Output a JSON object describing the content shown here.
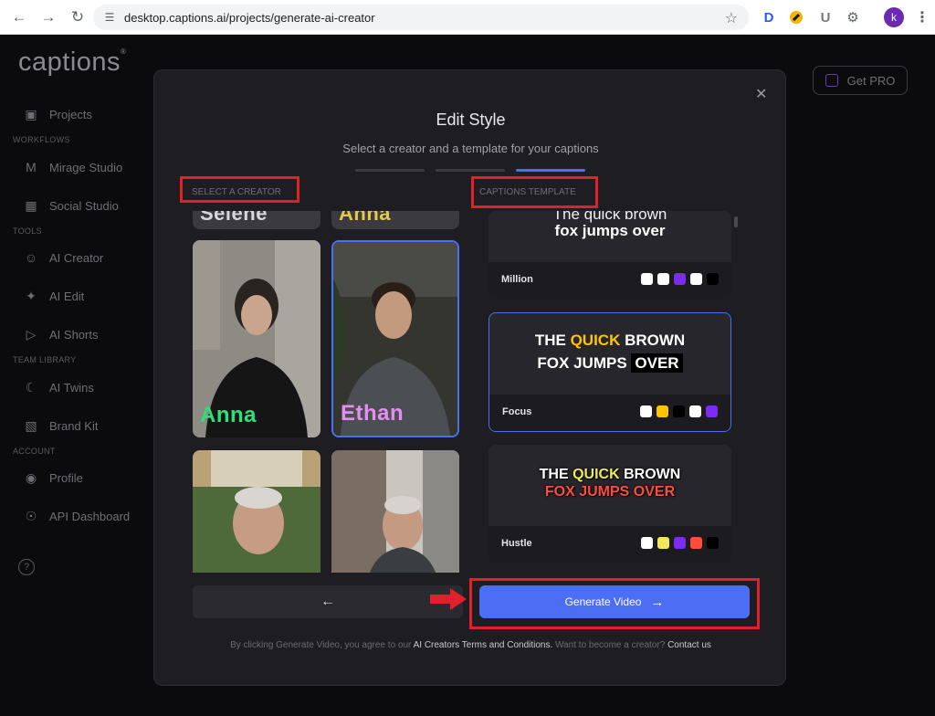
{
  "browser": {
    "url": "desktop.captions.ai/projects/generate-ai-creator",
    "profile_initial": "k",
    "ext_d": "D",
    "ext_u": "U"
  },
  "app": {
    "logo": "captions",
    "get_pro": "Get PRO",
    "sidebar": {
      "items": [
        {
          "label": "Projects",
          "icon": "projects-icon"
        },
        {
          "section": "WORKFLOWS"
        },
        {
          "label": "Mirage Studio",
          "icon": "mirage-icon"
        },
        {
          "label": "Social Studio",
          "icon": "social-icon"
        },
        {
          "section": "TOOLS"
        },
        {
          "label": "AI Creator",
          "icon": "ai-creator-icon"
        },
        {
          "label": "AI Edit",
          "icon": "ai-edit-icon"
        },
        {
          "label": "AI Shorts",
          "icon": "ai-shorts-icon"
        },
        {
          "section": "TEAM LIBRARY"
        },
        {
          "label": "AI Twins",
          "icon": "ai-twins-icon"
        },
        {
          "label": "Brand Kit",
          "icon": "brand-kit-icon"
        },
        {
          "section": "ACCOUNT"
        },
        {
          "label": "Profile",
          "icon": "profile-icon"
        },
        {
          "label": "API Dashboard",
          "icon": "api-icon"
        }
      ]
    }
  },
  "modal": {
    "title": "Edit Style",
    "subtitle": "Select a creator and a template for your captions",
    "steps_total": 3,
    "step_active": 3,
    "select_creator_label": "SELECT A CREATOR",
    "captions_template_label": "CAPTIONS TEMPLATE",
    "creators": [
      {
        "name": "Selene",
        "selected": false
      },
      {
        "name": "Anna",
        "selected": false
      },
      {
        "name": "Anna",
        "selected": false,
        "name_color": "#2ee07a"
      },
      {
        "name": "Ethan",
        "selected": true,
        "name_color": "#e58ef2"
      },
      {
        "name": "",
        "selected": false
      },
      {
        "name": "",
        "selected": false
      }
    ],
    "templates": [
      {
        "name": "Million",
        "line1": "The quick brown",
        "line2": "fox jumps over",
        "swatches": [
          "#ffffff",
          "#ffffff",
          "#7b2cf0",
          "#ffffff",
          "#000000"
        ]
      },
      {
        "name": "Focus",
        "line1a": "THE ",
        "line1b": "QUICK",
        "line1c": " BROWN",
        "line2a": "FOX JUMPS ",
        "line2b": "OVER",
        "selected": true,
        "swatches": [
          "#ffffff",
          "#ffc400",
          "#000000",
          "#ffffff",
          "#7b2cf0"
        ]
      },
      {
        "name": "Hustle",
        "line1a": "THE ",
        "line1b": "QUICK",
        "line1c": " BROWN",
        "line2": "FOX JUMPS OVER",
        "swatches": [
          "#ffffff",
          "#f2e85c",
          "#7b2cf0",
          "#ff4d3d",
          "#000000"
        ]
      }
    ],
    "back_button": "←",
    "generate_button": "Generate Video",
    "generate_arrow": "→",
    "footer_text": "By clicking Generate Video, you agree to our ",
    "footer_link1": "AI Creators Terms and Conditions.",
    "footer_mid": " Want to become a creator? ",
    "footer_link2": "Contact us"
  },
  "colors": {
    "accent": "#4c6ef5",
    "annotation_red": "#e0202a"
  }
}
